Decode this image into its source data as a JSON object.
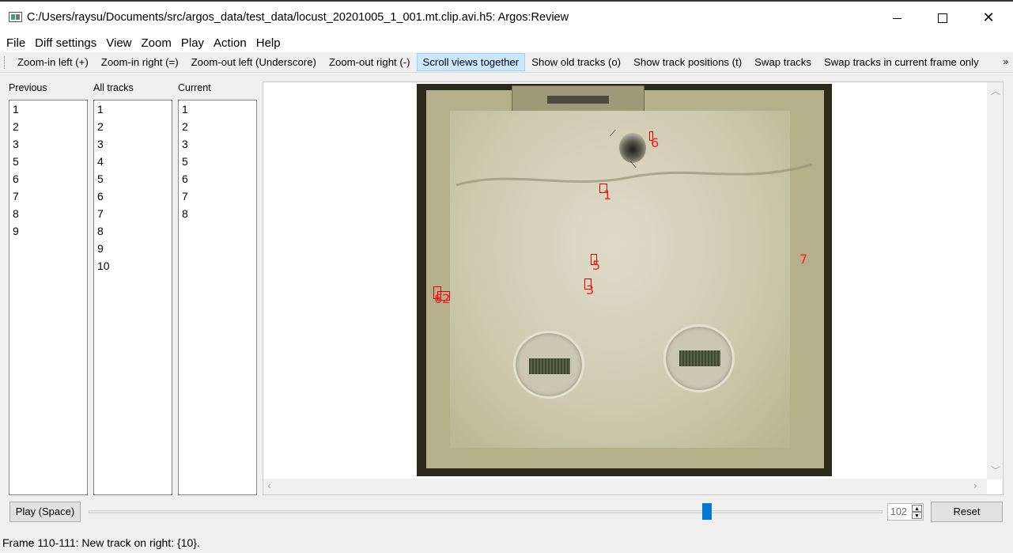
{
  "window": {
    "title": "C:/Users/raysu/Documents/src/argos_data/test_data/locust_20201005_1_001.mt.clip.avi.h5: Argos:Review"
  },
  "menu": [
    "File",
    "Diff settings",
    "View",
    "Zoom",
    "Play",
    "Action",
    "Help"
  ],
  "toolbar": {
    "buttons": [
      {
        "label": "Zoom-in left (+)",
        "checked": false
      },
      {
        "label": "Zoom-in right (=)",
        "checked": false
      },
      {
        "label": "Zoom-out left (Underscore)",
        "checked": false
      },
      {
        "label": "Zoom-out right (-)",
        "checked": false
      },
      {
        "label": "Scroll views together",
        "checked": true
      },
      {
        "label": "Show old tracks (o)",
        "checked": false
      },
      {
        "label": "Show track positions (t)",
        "checked": false
      },
      {
        "label": "Swap tracks",
        "checked": false
      },
      {
        "label": "Swap tracks in current frame only",
        "checked": false
      }
    ],
    "overflow": "»"
  },
  "lists": {
    "previous": {
      "label": "Previous",
      "items": [
        "1",
        "2",
        "3",
        "5",
        "6",
        "7",
        "8",
        "9"
      ]
    },
    "all_tracks": {
      "label": "All tracks",
      "items": [
        "1",
        "2",
        "3",
        "4",
        "5",
        "6",
        "7",
        "8",
        "9",
        "10"
      ]
    },
    "current": {
      "label": "Current",
      "items": [
        "1",
        "2",
        "3",
        "5",
        "6",
        "7",
        "8"
      ]
    }
  },
  "view": {
    "tracks": [
      "6",
      "1",
      "5",
      "3",
      "7",
      "62"
    ]
  },
  "controls": {
    "play_label": "Play (Space)",
    "slider_fraction": 0.779,
    "frame_value": "102",
    "reset_label": "Reset"
  },
  "status": {
    "text": "Frame 110-111: New track on right: {10}."
  },
  "colors": {
    "accent": "#0078d7",
    "track": "#ff1a1a",
    "checked_bg": "#cce8ff"
  }
}
